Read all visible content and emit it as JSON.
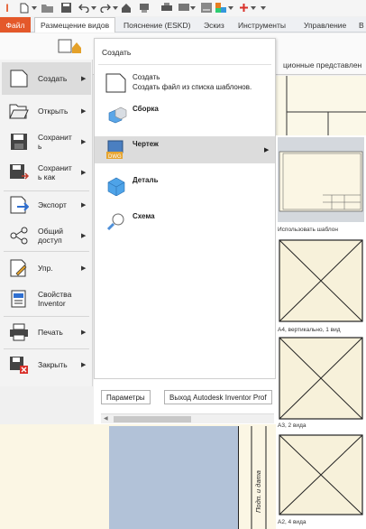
{
  "window": {
    "app_logo": "I"
  },
  "ribbon": {
    "file_tab": "Файл",
    "tabs": [
      "Размещение видов",
      "Пояснение (ESKD)",
      "Эскиз",
      "Инструменты",
      "Управление",
      "В"
    ],
    "panel_label": "ционные представлен"
  },
  "file_menu": {
    "items": [
      {
        "label": "Создать",
        "icon": "new-doc-icon",
        "has_submenu": true
      },
      {
        "label": "Открыть",
        "icon": "open-folder-icon",
        "has_submenu": true
      },
      {
        "label": "Сохранит\nь",
        "icon": "save-icon",
        "has_submenu": true
      },
      {
        "label": "Сохранит\nь как",
        "icon": "save-as-icon",
        "has_submenu": true
      },
      {
        "label": "Экспорт",
        "icon": "export-icon",
        "has_submenu": true
      },
      {
        "label": "Общий\nдоступ",
        "icon": "share-icon",
        "has_submenu": true
      },
      {
        "label": "Упр.",
        "icon": "manage-icon",
        "has_submenu": true
      },
      {
        "label": "Свойства\nInventor",
        "icon": "properties-icon",
        "has_submenu": false
      },
      {
        "label": "Печать",
        "icon": "print-icon",
        "has_submenu": true
      },
      {
        "label": "Закрыть",
        "icon": "close-doc-icon",
        "has_submenu": true
      }
    ]
  },
  "create_menu": {
    "title": "Создать",
    "items": [
      {
        "label": "Создать",
        "desc": "Создать файл из списка шаблонов.",
        "icon": "new-doc-icon"
      },
      {
        "label": "Сборка",
        "icon": "assembly-icon"
      },
      {
        "label": "Чертеж",
        "icon": "drawing-dwg-icon",
        "has_submenu": true
      },
      {
        "label": "Деталь",
        "icon": "part-icon"
      },
      {
        "label": "Схема",
        "icon": "presentation-icon"
      }
    ]
  },
  "templates": [
    {
      "caption": "Использовать шаблон"
    },
    {
      "caption": "A4, вертикально, 1 вид"
    },
    {
      "caption": "A3, 2 вида"
    },
    {
      "caption": "A2, 4 вида"
    }
  ],
  "bottom": {
    "options_button": "Параметры",
    "exit_button": "Выход Autodesk Inventor Prof"
  },
  "drawing": {
    "stamp_text": "Подп. и дата"
  },
  "colors": {
    "accent": "#e4582a",
    "highlight": "#dcdcdc",
    "sheet": "#fbf6e4",
    "view_fill": "#b2c2d8"
  }
}
